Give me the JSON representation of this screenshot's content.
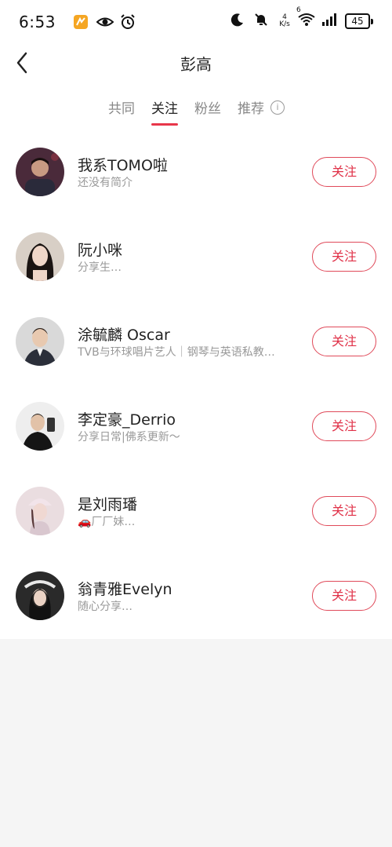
{
  "status_bar": {
    "time": "6:53",
    "speed_top": "4",
    "speed_unit": "K/s",
    "wifi_label": "6",
    "battery": "45"
  },
  "header": {
    "title": "彭高"
  },
  "tabs": [
    {
      "label": "共同",
      "active": false
    },
    {
      "label": "关注",
      "active": true
    },
    {
      "label": "粉丝",
      "active": false
    },
    {
      "label": "推荐",
      "active": false
    }
  ],
  "info_icon_glyph": "i",
  "users": [
    {
      "name": "我系TOMO啦",
      "desc": "还没有简介",
      "button": "关注"
    },
    {
      "name": "阮小咪",
      "desc": "分享生…",
      "button": "关注"
    },
    {
      "name": "涂毓麟 Oscar",
      "desc": "TVB与环球唱片艺人｜钢琴与英语私教…",
      "button": "关注"
    },
    {
      "name": "李定豪_Derrio",
      "desc": "分享日常|佛系更新～",
      "button": "关注"
    },
    {
      "name": "是刘雨璠",
      "desc": "🚗厂厂妹…",
      "button": "关注"
    },
    {
      "name": "翁青雅Evelyn",
      "desc": "随心分享…",
      "button": "关注"
    }
  ],
  "colors": {
    "accent": "#e8364a",
    "background": "#f5f5f5"
  }
}
